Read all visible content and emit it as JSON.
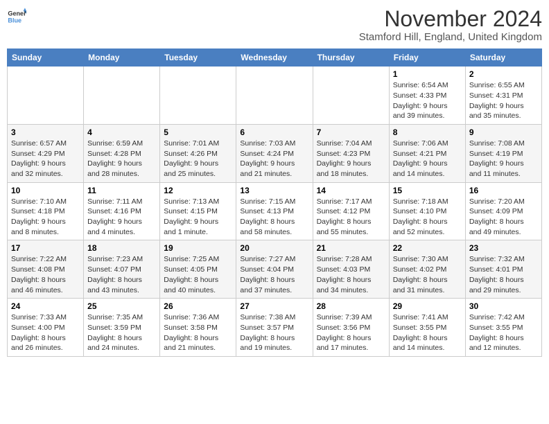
{
  "header": {
    "logo_line1": "General",
    "logo_line2": "Blue",
    "main_title": "November 2024",
    "subtitle": "Stamford Hill, England, United Kingdom"
  },
  "weekdays": [
    "Sunday",
    "Monday",
    "Tuesday",
    "Wednesday",
    "Thursday",
    "Friday",
    "Saturday"
  ],
  "weeks": [
    [
      {
        "day": "",
        "info": ""
      },
      {
        "day": "",
        "info": ""
      },
      {
        "day": "",
        "info": ""
      },
      {
        "day": "",
        "info": ""
      },
      {
        "day": "",
        "info": ""
      },
      {
        "day": "1",
        "info": "Sunrise: 6:54 AM\nSunset: 4:33 PM\nDaylight: 9 hours and 39 minutes."
      },
      {
        "day": "2",
        "info": "Sunrise: 6:55 AM\nSunset: 4:31 PM\nDaylight: 9 hours and 35 minutes."
      }
    ],
    [
      {
        "day": "3",
        "info": "Sunrise: 6:57 AM\nSunset: 4:29 PM\nDaylight: 9 hours and 32 minutes."
      },
      {
        "day": "4",
        "info": "Sunrise: 6:59 AM\nSunset: 4:28 PM\nDaylight: 9 hours and 28 minutes."
      },
      {
        "day": "5",
        "info": "Sunrise: 7:01 AM\nSunset: 4:26 PM\nDaylight: 9 hours and 25 minutes."
      },
      {
        "day": "6",
        "info": "Sunrise: 7:03 AM\nSunset: 4:24 PM\nDaylight: 9 hours and 21 minutes."
      },
      {
        "day": "7",
        "info": "Sunrise: 7:04 AM\nSunset: 4:23 PM\nDaylight: 9 hours and 18 minutes."
      },
      {
        "day": "8",
        "info": "Sunrise: 7:06 AM\nSunset: 4:21 PM\nDaylight: 9 hours and 14 minutes."
      },
      {
        "day": "9",
        "info": "Sunrise: 7:08 AM\nSunset: 4:19 PM\nDaylight: 9 hours and 11 minutes."
      }
    ],
    [
      {
        "day": "10",
        "info": "Sunrise: 7:10 AM\nSunset: 4:18 PM\nDaylight: 9 hours and 8 minutes."
      },
      {
        "day": "11",
        "info": "Sunrise: 7:11 AM\nSunset: 4:16 PM\nDaylight: 9 hours and 4 minutes."
      },
      {
        "day": "12",
        "info": "Sunrise: 7:13 AM\nSunset: 4:15 PM\nDaylight: 9 hours and 1 minute."
      },
      {
        "day": "13",
        "info": "Sunrise: 7:15 AM\nSunset: 4:13 PM\nDaylight: 8 hours and 58 minutes."
      },
      {
        "day": "14",
        "info": "Sunrise: 7:17 AM\nSunset: 4:12 PM\nDaylight: 8 hours and 55 minutes."
      },
      {
        "day": "15",
        "info": "Sunrise: 7:18 AM\nSunset: 4:10 PM\nDaylight: 8 hours and 52 minutes."
      },
      {
        "day": "16",
        "info": "Sunrise: 7:20 AM\nSunset: 4:09 PM\nDaylight: 8 hours and 49 minutes."
      }
    ],
    [
      {
        "day": "17",
        "info": "Sunrise: 7:22 AM\nSunset: 4:08 PM\nDaylight: 8 hours and 46 minutes."
      },
      {
        "day": "18",
        "info": "Sunrise: 7:23 AM\nSunset: 4:07 PM\nDaylight: 8 hours and 43 minutes."
      },
      {
        "day": "19",
        "info": "Sunrise: 7:25 AM\nSunset: 4:05 PM\nDaylight: 8 hours and 40 minutes."
      },
      {
        "day": "20",
        "info": "Sunrise: 7:27 AM\nSunset: 4:04 PM\nDaylight: 8 hours and 37 minutes."
      },
      {
        "day": "21",
        "info": "Sunrise: 7:28 AM\nSunset: 4:03 PM\nDaylight: 8 hours and 34 minutes."
      },
      {
        "day": "22",
        "info": "Sunrise: 7:30 AM\nSunset: 4:02 PM\nDaylight: 8 hours and 31 minutes."
      },
      {
        "day": "23",
        "info": "Sunrise: 7:32 AM\nSunset: 4:01 PM\nDaylight: 8 hours and 29 minutes."
      }
    ],
    [
      {
        "day": "24",
        "info": "Sunrise: 7:33 AM\nSunset: 4:00 PM\nDaylight: 8 hours and 26 minutes."
      },
      {
        "day": "25",
        "info": "Sunrise: 7:35 AM\nSunset: 3:59 PM\nDaylight: 8 hours and 24 minutes."
      },
      {
        "day": "26",
        "info": "Sunrise: 7:36 AM\nSunset: 3:58 PM\nDaylight: 8 hours and 21 minutes."
      },
      {
        "day": "27",
        "info": "Sunrise: 7:38 AM\nSunset: 3:57 PM\nDaylight: 8 hours and 19 minutes."
      },
      {
        "day": "28",
        "info": "Sunrise: 7:39 AM\nSunset: 3:56 PM\nDaylight: 8 hours and 17 minutes."
      },
      {
        "day": "29",
        "info": "Sunrise: 7:41 AM\nSunset: 3:55 PM\nDaylight: 8 hours and 14 minutes."
      },
      {
        "day": "30",
        "info": "Sunrise: 7:42 AM\nSunset: 3:55 PM\nDaylight: 8 hours and 12 minutes."
      }
    ]
  ]
}
